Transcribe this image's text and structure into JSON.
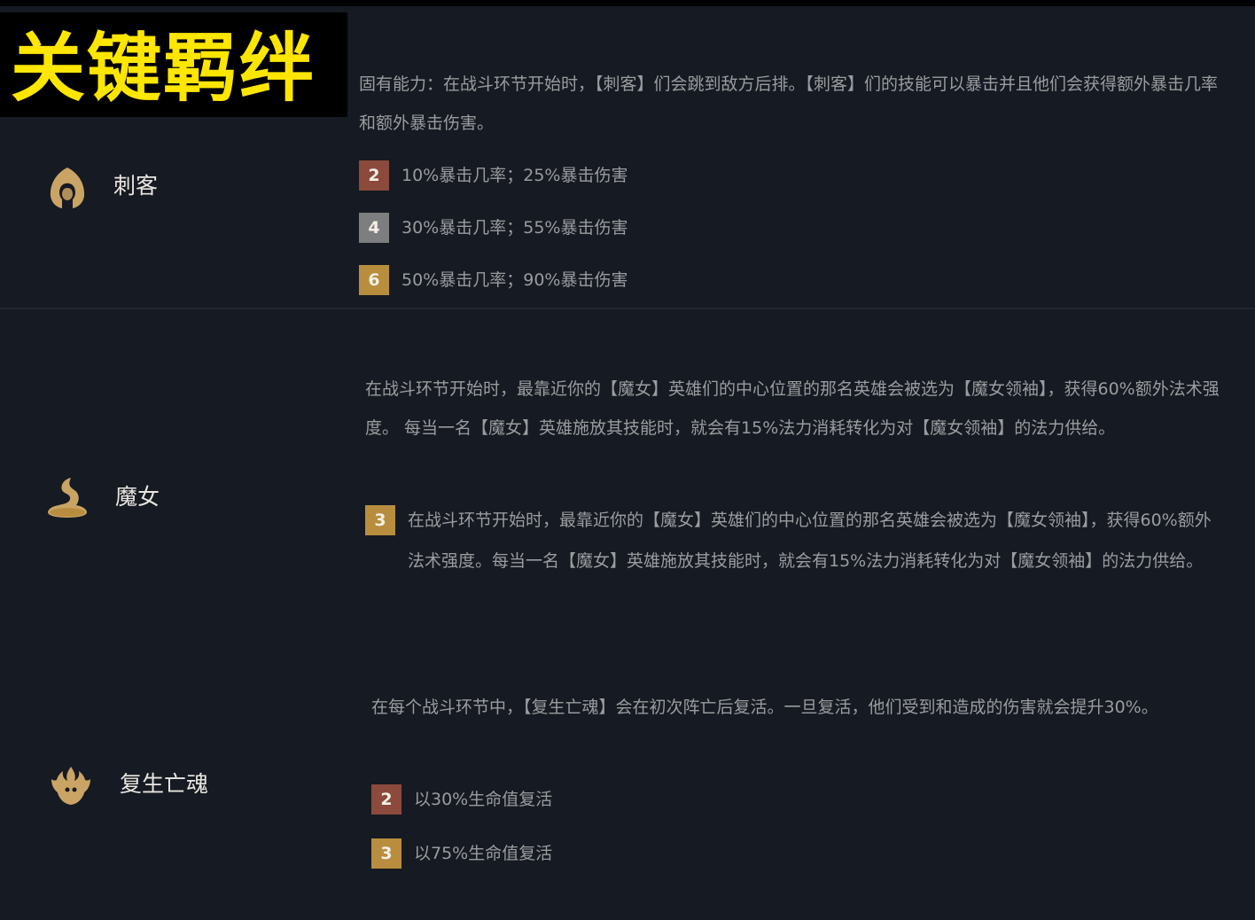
{
  "banner": {
    "title": "关键羁绊"
  },
  "colors": {
    "background": "#161a22",
    "banner_text": "#ffe600",
    "bronze": "#8c4a3c",
    "silver": "#7d7e80",
    "gold": "#b88e3e",
    "icon_gold": "#c9a464"
  },
  "traits": [
    {
      "name": "刺客",
      "icon": "hooded-assassin-icon",
      "description": "固有能力：在战斗环节开始时，【刺客】们会跳到敌方后排。【刺客】们的技能可以暴击并且他们会获得额外暴击几率和额外暴击伤害。",
      "tiers": [
        {
          "count": "2",
          "level": "bronze",
          "text": "10%暴击几率；25%暴击伤害"
        },
        {
          "count": "4",
          "level": "silver",
          "text": "30%暴击几率；55%暴击伤害"
        },
        {
          "count": "6",
          "level": "gold",
          "text": "50%暴击几率；90%暴击伤害"
        }
      ]
    },
    {
      "name": "魔女",
      "icon": "witch-hat-icon",
      "description": "在战斗环节开始时，最靠近你的【魔女】英雄们的中心位置的那名英雄会被选为【魔女领袖】，获得60%额外法术强度。 每当一名【魔女】英雄施放其技能时，就会有15%法力消耗转化为对【魔女领袖】的法力供给。",
      "tiers": [
        {
          "count": "3",
          "level": "gold",
          "text": "在战斗环节开始时，最靠近你的【魔女】英雄们的中心位置的那名英雄会被选为【魔女领袖】，获得60%额外法术强度。每当一名【魔女】英雄施放其技能时，就会有15%法力消耗转化为对【魔女领袖】的法力供给。"
        }
      ]
    },
    {
      "name": "复生亡魂",
      "icon": "revenant-flame-icon",
      "description": "在每个战斗环节中，【复生亡魂】会在初次阵亡后复活。一旦复活，他们受到和造成的伤害就会提升30%。",
      "tiers": [
        {
          "count": "2",
          "level": "bronze",
          "text": "以30%生命值复活"
        },
        {
          "count": "3",
          "level": "gold",
          "text": "以75%生命值复活"
        }
      ]
    }
  ]
}
